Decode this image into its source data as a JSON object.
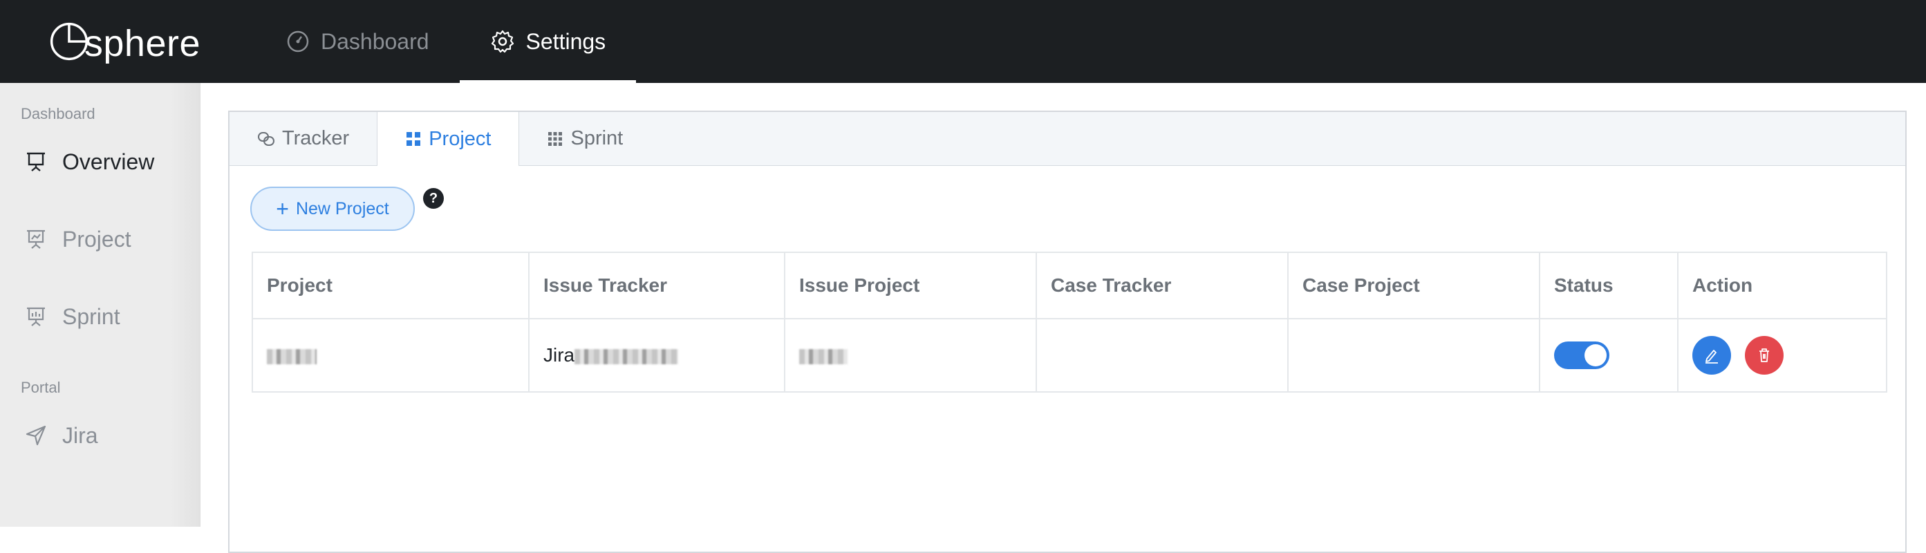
{
  "app": {
    "logo_text": "sphere"
  },
  "topnav": [
    {
      "label": "Dashboard",
      "icon": "speedometer-icon",
      "active": false
    },
    {
      "label": "Settings",
      "icon": "gear-icon",
      "active": true
    }
  ],
  "sidebar": {
    "sections": [
      {
        "title": "Dashboard",
        "items": [
          {
            "label": "Overview",
            "icon": "presentation-icon",
            "active": true
          },
          {
            "label": "Project",
            "icon": "presentation-chart-icon",
            "active": false
          },
          {
            "label": "Sprint",
            "icon": "presentation-chart-icon",
            "active": false
          }
        ]
      },
      {
        "title": "Portal",
        "items": [
          {
            "label": "Jira",
            "icon": "send-icon",
            "active": false
          }
        ]
      }
    ]
  },
  "tabs": [
    {
      "label": "Tracker",
      "icon": "link-icon",
      "active": false
    },
    {
      "label": "Project",
      "icon": "grid-icon",
      "active": true
    },
    {
      "label": "Sprint",
      "icon": "grid-dots-icon",
      "active": false
    }
  ],
  "toolbar": {
    "new_button": "New Project",
    "help": "?"
  },
  "table": {
    "headers": [
      "Project",
      "Issue Tracker",
      "Issue Project",
      "Case Tracker",
      "Case Project",
      "Status",
      "Action"
    ],
    "rows": [
      {
        "issue_tracker_prefix": "Jira",
        "case_tracker": "",
        "case_project": "",
        "status_enabled": true
      }
    ]
  },
  "colors": {
    "accent": "#2f7de1",
    "danger": "#e4474d",
    "topbar": "#1c1f22"
  }
}
